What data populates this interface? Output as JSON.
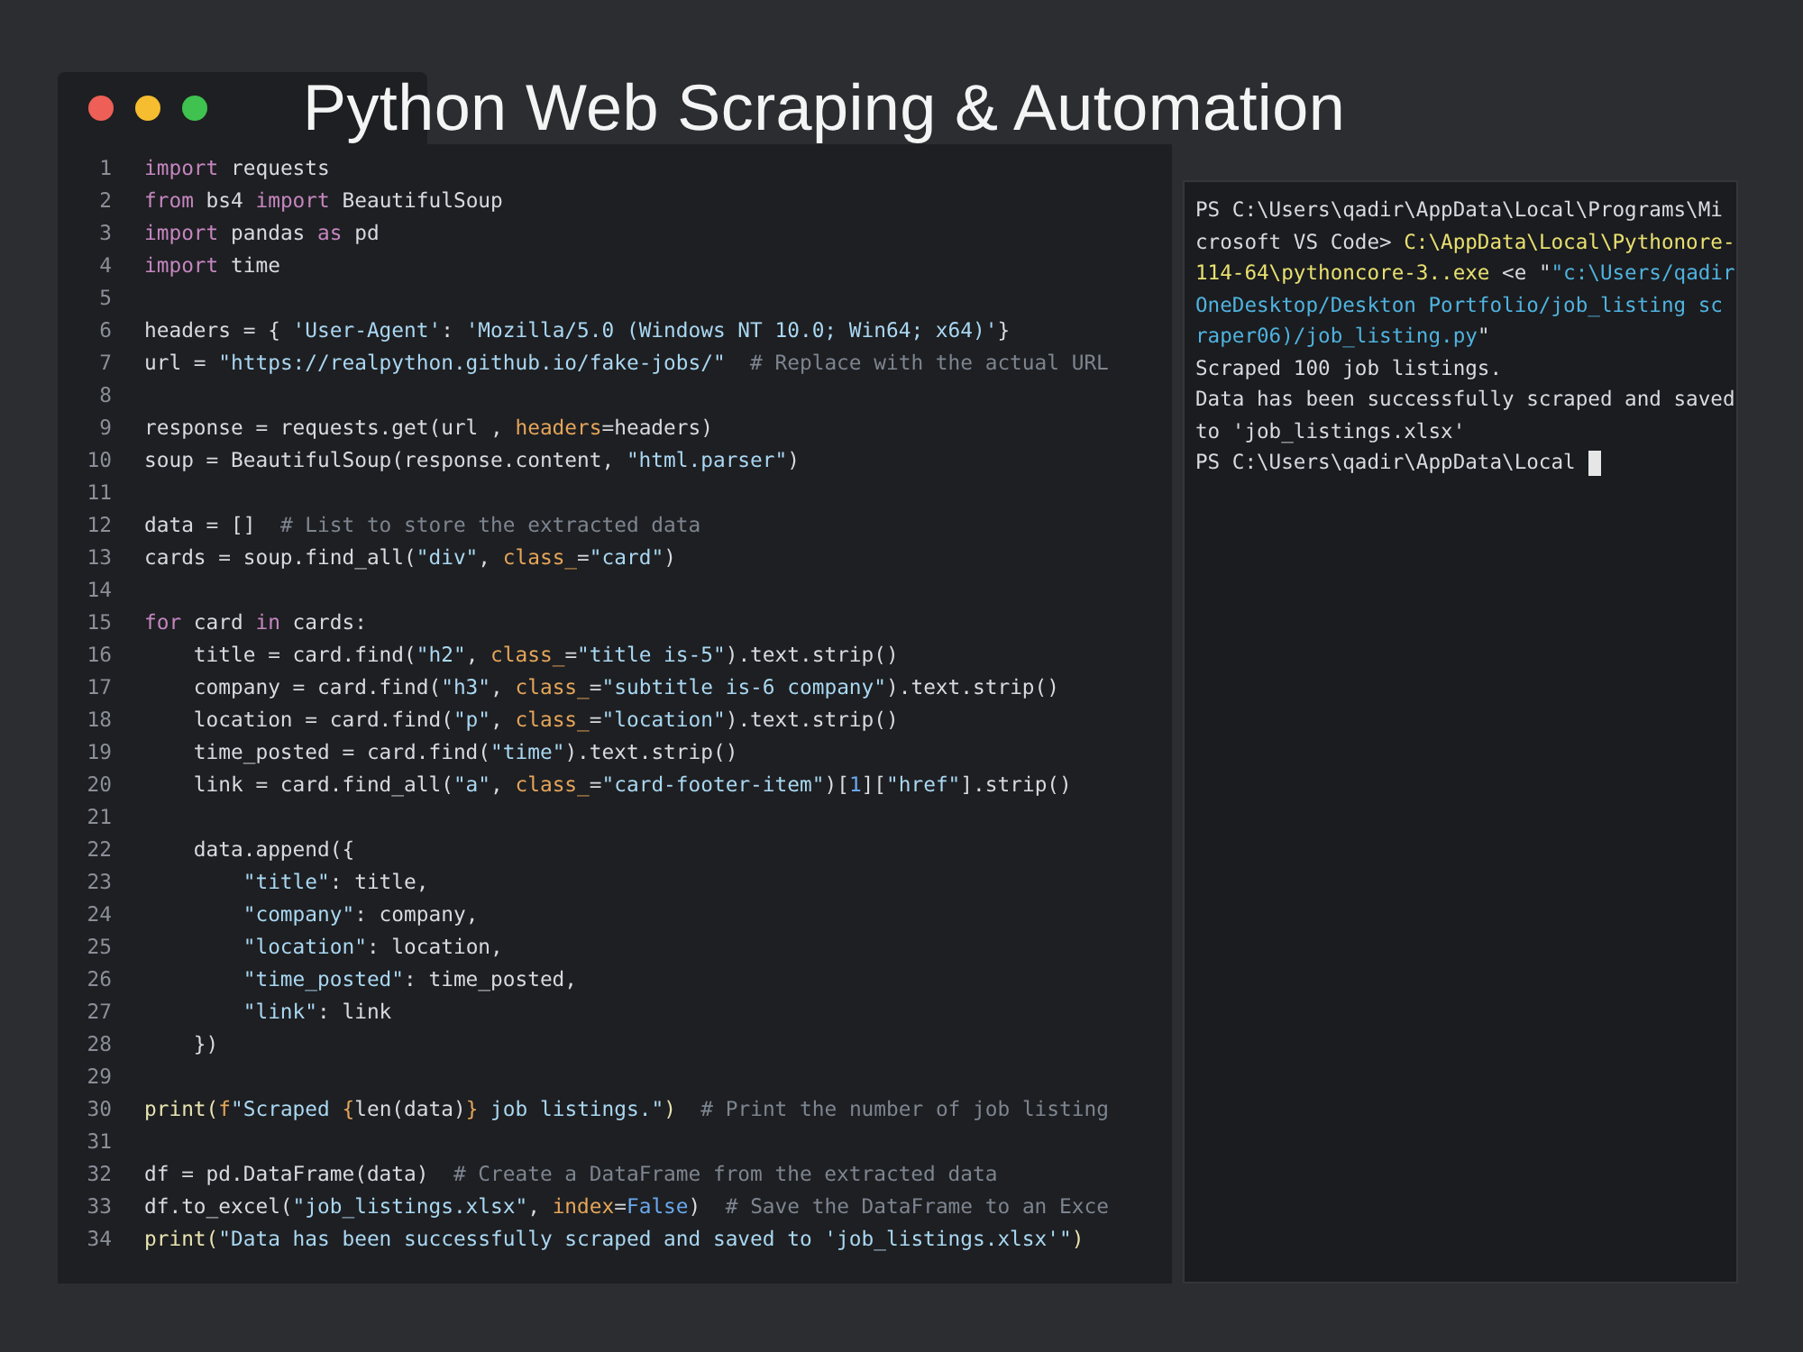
{
  "title": "Python Web Scraping & Automation",
  "window_controls": [
    {
      "color": "#ee5f57"
    },
    {
      "color": "#f5bd2f"
    },
    {
      "color": "#3fc24f"
    }
  ],
  "editor": {
    "lines": [
      {
        "num": "1",
        "tokens": [
          {
            "kind": "kw",
            "text": "import"
          },
          {
            "kind": "plain",
            "text": " requests"
          }
        ]
      },
      {
        "num": "2",
        "tokens": [
          {
            "kind": "kw",
            "text": "from"
          },
          {
            "kind": "plain",
            "text": " bs4 "
          },
          {
            "kind": "kw",
            "text": "import"
          },
          {
            "kind": "plain",
            "text": " BeautifulSoup"
          }
        ]
      },
      {
        "num": "3",
        "tokens": [
          {
            "kind": "kw",
            "text": "import"
          },
          {
            "kind": "plain",
            "text": " pandas "
          },
          {
            "kind": "kw",
            "text": "as"
          },
          {
            "kind": "plain",
            "text": " pd"
          }
        ]
      },
      {
        "num": "4",
        "tokens": [
          {
            "kind": "kw",
            "text": "import"
          },
          {
            "kind": "plain",
            "text": " time"
          }
        ]
      },
      {
        "num": "5"
      },
      {
        "num": "6",
        "tokens": [
          {
            "kind": "plain",
            "text": "headers = { "
          },
          {
            "kind": "str",
            "text": "'User-Agent'"
          },
          {
            "kind": "plain",
            "text": ": "
          },
          {
            "kind": "str",
            "text": "'Mozilla/5.0 (Windows NT 10.0; Win64; x64)'"
          },
          {
            "kind": "plain",
            "text": "}"
          }
        ]
      },
      {
        "num": "7",
        "tokens": [
          {
            "kind": "plain",
            "text": "url = "
          },
          {
            "kind": "str",
            "text": "\"https://realpython.github.io/fake-jobs/\""
          },
          {
            "kind": "com",
            "text": "  # Replace with the actual URL"
          }
        ]
      },
      {
        "num": "8"
      },
      {
        "num": "9",
        "tokens": [
          {
            "kind": "plain",
            "text": "response = requests.get(url , "
          },
          {
            "kind": "param",
            "text": "headers"
          },
          {
            "kind": "plain",
            "text": "=headers)"
          }
        ]
      },
      {
        "num": "10",
        "tokens": [
          {
            "kind": "plain",
            "text": "soup = BeautifulSoup(response.content, "
          },
          {
            "kind": "str",
            "text": "\"html.parser\""
          },
          {
            "kind": "plain",
            "text": ")"
          }
        ]
      },
      {
        "num": "11"
      },
      {
        "num": "12",
        "tokens": [
          {
            "kind": "plain",
            "text": "data = []"
          },
          {
            "kind": "com",
            "text": "  # List to store the extracted data"
          }
        ]
      },
      {
        "num": "13",
        "tokens": [
          {
            "kind": "plain",
            "text": "cards = soup.find_all("
          },
          {
            "kind": "str",
            "text": "\"div\""
          },
          {
            "kind": "plain",
            "text": ", "
          },
          {
            "kind": "param",
            "text": "class_"
          },
          {
            "kind": "plain",
            "text": "="
          },
          {
            "kind": "str",
            "text": "\"card\""
          },
          {
            "kind": "plain",
            "text": ")"
          }
        ]
      },
      {
        "num": "14"
      },
      {
        "num": "15",
        "tokens": [
          {
            "kind": "kw",
            "text": "for"
          },
          {
            "kind": "plain",
            "text": " card "
          },
          {
            "kind": "kw",
            "text": "in"
          },
          {
            "kind": "plain",
            "text": " cards:"
          }
        ]
      },
      {
        "num": "16",
        "tokens": [
          {
            "kind": "plain",
            "text": "    title = card.find("
          },
          {
            "kind": "str",
            "text": "\"h2\""
          },
          {
            "kind": "plain",
            "text": ", "
          },
          {
            "kind": "param",
            "text": "class_"
          },
          {
            "kind": "plain",
            "text": "="
          },
          {
            "kind": "str",
            "text": "\"title is-5\""
          },
          {
            "kind": "plain",
            "text": ").text.strip()"
          }
        ]
      },
      {
        "num": "17",
        "tokens": [
          {
            "kind": "plain",
            "text": "    company = card.find("
          },
          {
            "kind": "str",
            "text": "\"h3\""
          },
          {
            "kind": "plain",
            "text": ", "
          },
          {
            "kind": "param",
            "text": "class_"
          },
          {
            "kind": "plain",
            "text": "="
          },
          {
            "kind": "str",
            "text": "\"subtitle is-6 company\""
          },
          {
            "kind": "plain",
            "text": ").text.strip()"
          }
        ]
      },
      {
        "num": "18",
        "tokens": [
          {
            "kind": "plain",
            "text": "    location = card.find("
          },
          {
            "kind": "str",
            "text": "\"p\""
          },
          {
            "kind": "plain",
            "text": ", "
          },
          {
            "kind": "param",
            "text": "class_"
          },
          {
            "kind": "plain",
            "text": "="
          },
          {
            "kind": "str",
            "text": "\"location\""
          },
          {
            "kind": "plain",
            "text": ").text.strip()"
          }
        ]
      },
      {
        "num": "19",
        "tokens": [
          {
            "kind": "plain",
            "text": "    time_posted = card.find("
          },
          {
            "kind": "str",
            "text": "\"time\""
          },
          {
            "kind": "plain",
            "text": ").text.strip()"
          }
        ]
      },
      {
        "num": "20",
        "tokens": [
          {
            "kind": "plain",
            "text": "    link = card.find_all("
          },
          {
            "kind": "str",
            "text": "\"a\""
          },
          {
            "kind": "plain",
            "text": ", "
          },
          {
            "kind": "param",
            "text": "class_"
          },
          {
            "kind": "plain",
            "text": "="
          },
          {
            "kind": "str",
            "text": "\"card-footer-item\""
          },
          {
            "kind": "plain",
            "text": ")["
          },
          {
            "kind": "const",
            "text": "1"
          },
          {
            "kind": "plain",
            "text": "]["
          },
          {
            "kind": "str",
            "text": "\"href\""
          },
          {
            "kind": "plain",
            "text": "].strip()"
          }
        ]
      },
      {
        "num": "21"
      },
      {
        "num": "22",
        "tokens": [
          {
            "kind": "plain",
            "text": "    data.append({"
          }
        ]
      },
      {
        "num": "23",
        "tokens": [
          {
            "kind": "str",
            "text": "        \"title\""
          },
          {
            "kind": "plain",
            "text": ": title,"
          }
        ]
      },
      {
        "num": "24",
        "tokens": [
          {
            "kind": "str",
            "text": "        \"company\""
          },
          {
            "kind": "plain",
            "text": ": company,"
          }
        ]
      },
      {
        "num": "25",
        "tokens": [
          {
            "kind": "str",
            "text": "        \"location\""
          },
          {
            "kind": "plain",
            "text": ": location,"
          }
        ]
      },
      {
        "num": "26",
        "tokens": [
          {
            "kind": "str",
            "text": "        \"time_posted\""
          },
          {
            "kind": "plain",
            "text": ": time_posted,"
          }
        ]
      },
      {
        "num": "27",
        "tokens": [
          {
            "kind": "str",
            "text": "        \"link\""
          },
          {
            "kind": "plain",
            "text": ": link"
          }
        ]
      },
      {
        "num": "28",
        "tokens": [
          {
            "kind": "plain",
            "text": "    })"
          }
        ]
      },
      {
        "num": "29"
      },
      {
        "num": "30",
        "tokens": [
          {
            "kind": "fn",
            "text": "print("
          },
          {
            "kind": "param",
            "text": "f"
          },
          {
            "kind": "str",
            "text": "\"Scraped "
          },
          {
            "kind": "param",
            "text": "{"
          },
          {
            "kind": "plain",
            "text": "len(data)"
          },
          {
            "kind": "param",
            "text": "}"
          },
          {
            "kind": "str",
            "text": " job listings.\""
          },
          {
            "kind": "fn",
            "text": ")"
          },
          {
            "kind": "com",
            "text": "  # Print the number of job listing"
          }
        ]
      },
      {
        "num": "31"
      },
      {
        "num": "32",
        "tokens": [
          {
            "kind": "plain",
            "text": "df = pd.DataFrame(data)"
          },
          {
            "kind": "com",
            "text": "  # Create a DataFrame from the extracted data"
          }
        ]
      },
      {
        "num": "33",
        "tokens": [
          {
            "kind": "plain",
            "text": "df.to_excel("
          },
          {
            "kind": "str",
            "text": "\"job_listings.xlsx\""
          },
          {
            "kind": "plain",
            "text": ", "
          },
          {
            "kind": "param",
            "text": "index"
          },
          {
            "kind": "plain",
            "text": "="
          },
          {
            "kind": "const",
            "text": "False"
          },
          {
            "kind": "plain",
            "text": ")"
          },
          {
            "kind": "com",
            "text": "  # Save the DataFrame to an Exce"
          }
        ]
      },
      {
        "num": "34",
        "tokens": [
          {
            "kind": "fn",
            "text": "print("
          },
          {
            "kind": "str",
            "text": "\"Data has been successfully scraped and saved to 'job_listings.xlsx'\""
          },
          {
            "kind": "fn",
            "text": ")"
          }
        ]
      }
    ]
  },
  "terminal": {
    "lines": [
      [
        {
          "kind": "plain",
          "text": "PS C:\\Users\\qadir\\AppData\\Local\\Programs\\Mi"
        }
      ],
      [
        {
          "kind": "plain",
          "text": "crosoft VS Code> "
        },
        {
          "kind": "path",
          "text": "C:\\AppData\\Local\\Pythonore-"
        }
      ],
      [
        {
          "kind": "path",
          "text": "114-64\\pythoncore-3..exe"
        },
        {
          "kind": "plain",
          "text": " <e \""
        },
        {
          "kind": "link",
          "text": "\"c:\\Users/qadir"
        }
      ],
      [
        {
          "kind": "link",
          "text": "OneDesktop/Deskton Portfolio/job_listing sc"
        }
      ],
      [
        {
          "kind": "link",
          "text": "raper06)/job_listing.py"
        },
        {
          "kind": "plain",
          "text": "\""
        }
      ],
      [
        {
          "kind": "plain",
          "text": "Scraped 100 job listings."
        }
      ],
      [
        {
          "kind": "plain",
          "text": "Data has been successfully scraped and saved"
        }
      ],
      [
        {
          "kind": "plain",
          "text": "to 'job_listings.xlsx'"
        }
      ],
      [
        {
          "kind": "plain",
          "text": "PS C:\\Users\\qadir\\AppData\\Local "
        }
      ]
    ]
  }
}
